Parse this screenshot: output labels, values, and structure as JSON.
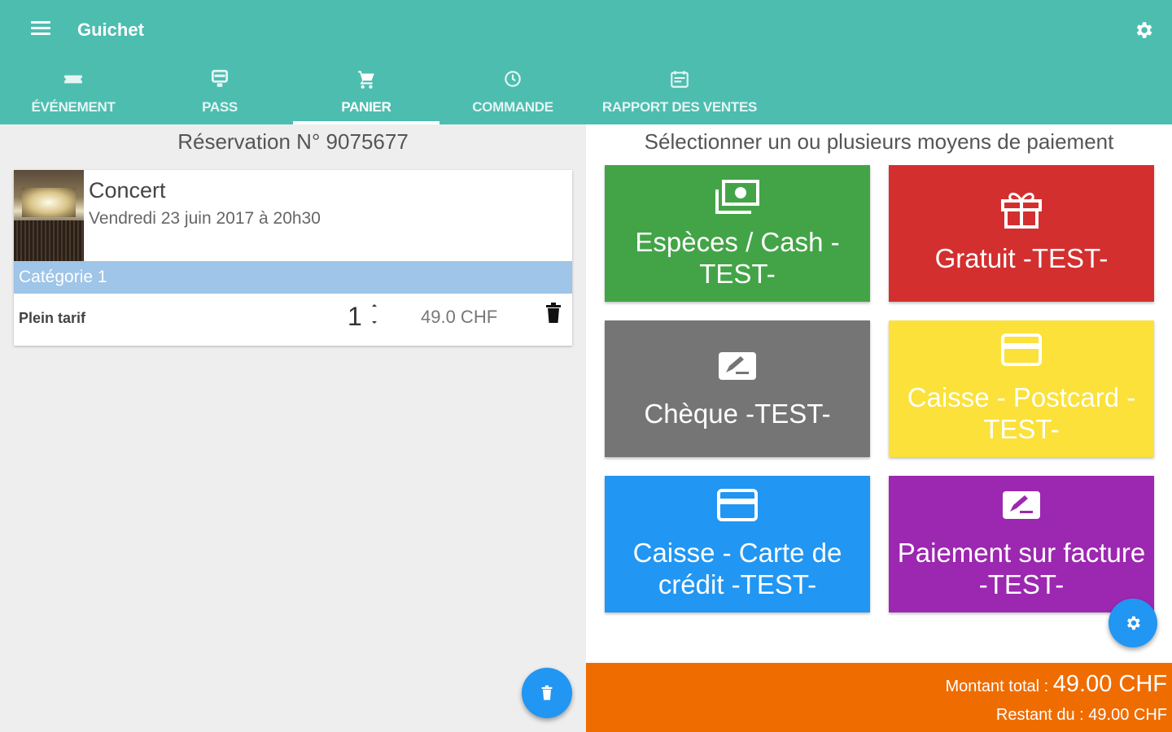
{
  "app": {
    "title": "Guichet"
  },
  "tabs": [
    {
      "label": "ÉVÉNEMENT",
      "icon": "ticket-icon"
    },
    {
      "label": "PASS",
      "icon": "pass-icon"
    },
    {
      "label": "PANIER",
      "icon": "cart-icon",
      "active": true
    },
    {
      "label": "COMMANDE",
      "icon": "clock-icon"
    },
    {
      "label": "RAPPORT DES VENTES",
      "icon": "calendar-icon"
    }
  ],
  "reservation": {
    "title": "Réservation N° 9075677",
    "event_name": "Concert",
    "event_date": "Vendredi 23 juin 2017 à 20h30",
    "category": "Catégorie 1",
    "ticket_type": "Plein tarif",
    "quantity": "1",
    "price": "49.0 CHF"
  },
  "payment": {
    "title": "Sélectionner un ou plusieurs moyens de paiement",
    "methods": [
      {
        "label": "Espèces / Cash -TEST-",
        "icon": "cash-icon",
        "color": "#43a447"
      },
      {
        "label": "Gratuit -TEST-",
        "icon": "gift-icon",
        "color": "#d32f2f"
      },
      {
        "label": "Chèque -TEST-",
        "icon": "cheque-icon",
        "color": "#757575"
      },
      {
        "label": "Caisse - Postcard -TEST-",
        "icon": "card-icon",
        "color": "#fbe13a"
      },
      {
        "label": "Caisse - Carte de crédit -TEST-",
        "icon": "credit-card-icon",
        "color": "#2196f3"
      },
      {
        "label": "Paiement sur facture -TEST-",
        "icon": "invoice-icon",
        "color": "#9c27b0"
      }
    ]
  },
  "totals": {
    "total_label": "Montant total : ",
    "total_value": "49.00 CHF",
    "remaining_label": "Restant du : ",
    "remaining_value": "49.00 CHF"
  },
  "colors": {
    "appbar": "#4dbdb0",
    "accent": "#2196f3",
    "total_bar": "#ef6c00"
  }
}
